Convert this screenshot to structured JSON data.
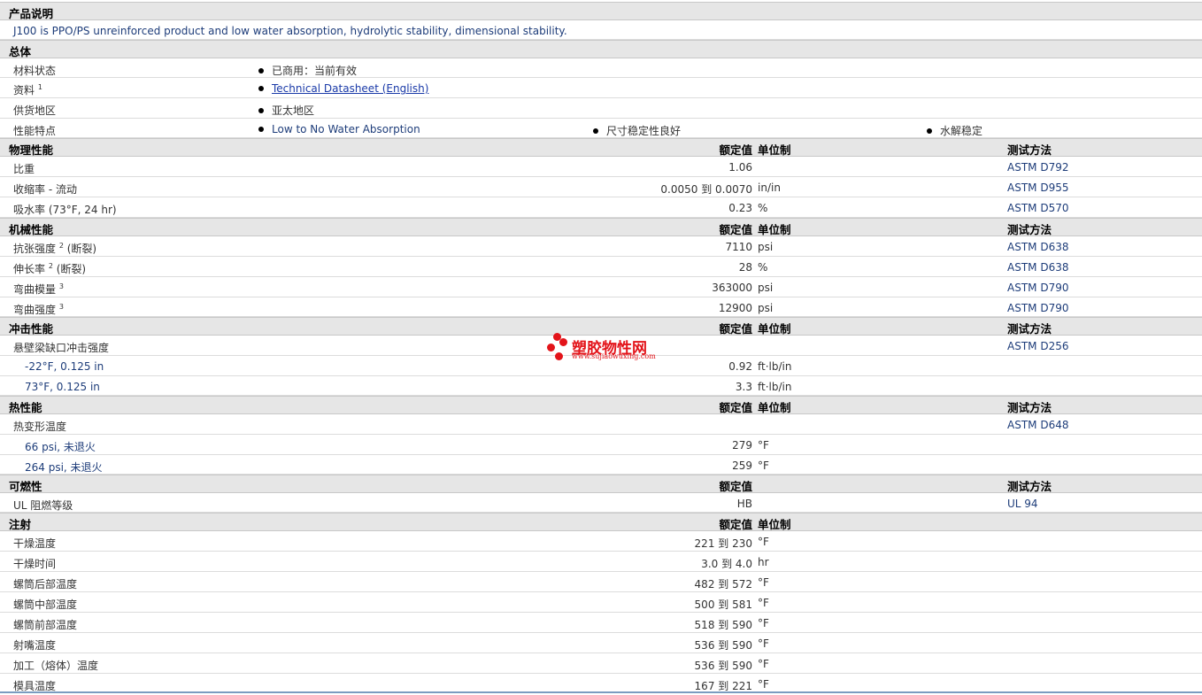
{
  "desc": {
    "header": "产品说明",
    "text": "J100 is PPO/PS unreinforced product and low water absorption, hydrolytic stability, dimensional stability."
  },
  "general": {
    "header": "总体",
    "material_status_label": "材料状态",
    "material_status_value": "已商用：当前有效",
    "docs_label": "资料",
    "docs_sup": "1",
    "docs_link": "Technical Datasheet (English)",
    "supply_label": "供货地区",
    "supply_value": "亚太地区",
    "features_label": "性能特点",
    "features": [
      "Low to No Water Absorption",
      "尺寸稳定性良好",
      "水解稳定"
    ]
  },
  "hdr": {
    "nominal": "额定值",
    "unit_sys": "单位制",
    "test": "测试方法"
  },
  "physical": {
    "header": "物理性能",
    "rows": [
      {
        "label": "比重",
        "value": "1.06",
        "unit": "",
        "test": "ASTM D792"
      },
      {
        "label": "收缩率  - 流动",
        "value": "0.0050 到  0.0070",
        "unit": "in/in",
        "test": "ASTM D955"
      },
      {
        "label": "吸水率  (73°F, 24 hr)",
        "value": "0.23",
        "unit": "%",
        "test": "ASTM D570"
      }
    ]
  },
  "mechanical": {
    "header": "机械性能",
    "rows": [
      {
        "label": "抗张强度",
        "sup": "2",
        "suffix": " (断裂)",
        "value": "7110",
        "unit": "psi",
        "test": "ASTM D638"
      },
      {
        "label": "伸长率",
        "sup": "2",
        "suffix": " (断裂)",
        "value": "28",
        "unit": "%",
        "test": "ASTM D638"
      },
      {
        "label": "弯曲模量",
        "sup": "3",
        "suffix": "",
        "value": "363000",
        "unit": "psi",
        "test": "ASTM D790"
      },
      {
        "label": "弯曲强度",
        "sup": "3",
        "suffix": "",
        "value": "12900",
        "unit": "psi",
        "test": "ASTM D790"
      }
    ]
  },
  "impact": {
    "header": "冲击性能",
    "main_label": "悬壁梁缺口冲击强度",
    "main_test": "ASTM D256",
    "rows": [
      {
        "label": "-22°F, 0.125 in",
        "value": "0.92",
        "unit": "ft·lb/in"
      },
      {
        "label": "73°F, 0.125 in",
        "value": "3.3",
        "unit": "ft·lb/in"
      }
    ]
  },
  "thermal": {
    "header": "热性能",
    "main_label": "热变形温度",
    "main_test": "ASTM D648",
    "rows": [
      {
        "label": "66 psi, 未退火",
        "value": "279",
        "unit": "°F"
      },
      {
        "label": "264 psi, 未退火",
        "value": "259",
        "unit": "°F"
      }
    ]
  },
  "flammability": {
    "header": "可燃性",
    "rows": [
      {
        "label": "UL 阻燃等级",
        "value": "HB",
        "test": "UL 94"
      }
    ]
  },
  "injection": {
    "header": "注射",
    "rows": [
      {
        "label": "干燥温度",
        "value": "221 到  230",
        "unit": "°F"
      },
      {
        "label": "干燥时间",
        "value": "3.0 到  4.0",
        "unit": "hr"
      },
      {
        "label": "螺筒后部温度",
        "value": "482 到  572",
        "unit": "°F"
      },
      {
        "label": "螺筒中部温度",
        "value": "500 到  581",
        "unit": "°F"
      },
      {
        "label": "螺筒前部温度",
        "value": "518 到  590",
        "unit": "°F"
      },
      {
        "label": "射嘴温度",
        "value": "536 到  590",
        "unit": "°F"
      },
      {
        "label": "加工（熔体）温度",
        "value": "536 到  590",
        "unit": "°F"
      },
      {
        "label": "模具温度",
        "value": "167 到  221",
        "unit": "°F"
      }
    ]
  },
  "watermark": {
    "name": "塑胶物性网",
    "url": "www.sujiaowuxing.com"
  }
}
